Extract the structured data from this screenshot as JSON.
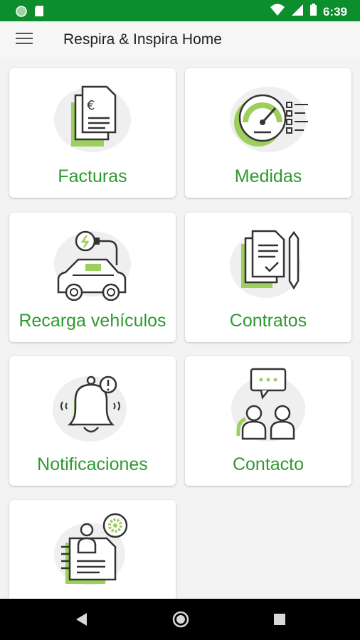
{
  "status_bar": {
    "time": "6:39"
  },
  "app_bar": {
    "title": "Respira & Inspira Home"
  },
  "colors": {
    "accent": "#2e9a2e",
    "status_bar": "#0b8e2b",
    "icon_green": "#9ccf5c",
    "icon_stroke": "#333333"
  },
  "tiles": [
    {
      "label": "Facturas",
      "icon": "invoice-icon"
    },
    {
      "label": "Medidas",
      "icon": "gauge-icon"
    },
    {
      "label": "Recarga vehículos",
      "icon": "ev-charging-icon"
    },
    {
      "label": "Contratos",
      "icon": "contract-icon"
    },
    {
      "label": "Notificaciones",
      "icon": "bell-icon"
    },
    {
      "label": "Contacto",
      "icon": "contact-icon"
    },
    {
      "label": "",
      "icon": "profile-settings-icon"
    }
  ]
}
